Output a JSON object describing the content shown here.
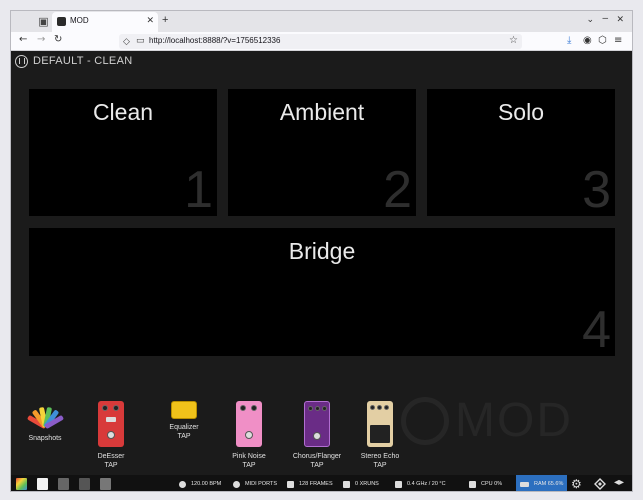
{
  "browser": {
    "tab_title": "MOD",
    "url": "http://localhost:8888/?v=1756512336",
    "new_tab_symbol": "+",
    "close_symbol": "✕"
  },
  "pedalboard": {
    "title": "DEFAULT - CLEAN"
  },
  "scenes": [
    {
      "name": "Clean",
      "number": "1"
    },
    {
      "name": "Ambient",
      "number": "2"
    },
    {
      "name": "Solo",
      "number": "3"
    },
    {
      "name": "Bridge",
      "number": "4"
    }
  ],
  "tray": {
    "snapshots_label": "Snapshots",
    "watermark": "MOD",
    "pedals": [
      {
        "name": "DeEsser",
        "brand": "TAP"
      },
      {
        "name": "Equalizer",
        "brand": "TAP"
      },
      {
        "name": "Pink Noise",
        "brand": "TAP"
      },
      {
        "name": "Chorus/Flanger",
        "brand": "TAP"
      },
      {
        "name": "Stereo Echo",
        "brand": "TAP"
      }
    ]
  },
  "statusbar": {
    "bpm": "120.00 BPM",
    "midi": "MIDI PORTS",
    "frames": "128 FRAMES",
    "xruns": "0 XRUNS",
    "clock": "0.4 GHz / 20 °C",
    "cpu": "CPU 0%",
    "ram": "RAM 65.6%"
  },
  "colors": {
    "ram_highlight": "#2c6fbf",
    "deesser": "#d83a3a",
    "equalizer": "#f0c21a",
    "pinknoise": "#f08fc6",
    "chorus": "#6a2c86",
    "echo": "#e3cfa4"
  }
}
